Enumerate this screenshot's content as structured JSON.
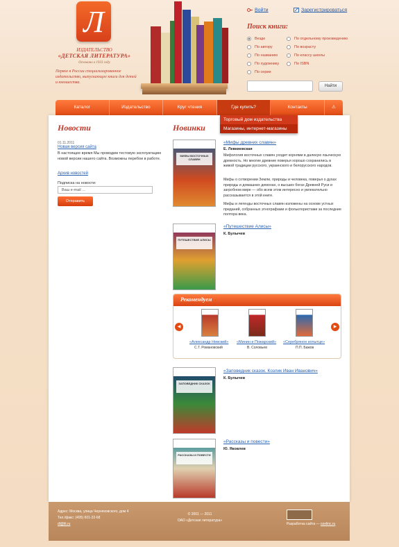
{
  "brand": {
    "logo_letter": "Л",
    "line1": "ИЗДАТЕЛЬСТВО",
    "line2": "«ДЕТСКАЯ ЛИТЕРАТУРА»",
    "founded": "Основано в 1933 году",
    "tagline": "Первое в России специализированное издательство, выпускающее книги для детей и юношества."
  },
  "auth": {
    "login": "Войти",
    "register": "Зарегистрироваться"
  },
  "search": {
    "title": "Поиск книги:",
    "options": [
      {
        "label": "Везде",
        "checked": true
      },
      {
        "label": "По отдельному произведению",
        "checked": false
      },
      {
        "label": "По автору",
        "checked": false
      },
      {
        "label": "По возрасту",
        "checked": false
      },
      {
        "label": "По названию",
        "checked": false
      },
      {
        "label": "По классу школы",
        "checked": false
      },
      {
        "label": "По художнику",
        "checked": false
      },
      {
        "label": "По ISBN",
        "checked": false
      },
      {
        "label": "По серии",
        "checked": false
      }
    ],
    "query": "",
    "button": "Найти"
  },
  "nav": {
    "items": [
      "Каталог",
      "Издательство",
      "Круг чтения",
      "Где купить?",
      "Контакты",
      "⚠"
    ],
    "active_index": 3,
    "dropdown": [
      "Торговый дом издательства",
      "Магазины, интернет-магазины"
    ]
  },
  "news": {
    "title": "Новости",
    "date": "01.11.2011",
    "headline": "Новая версия сайта",
    "text": "В настоящее время Мы проводим тестовую эксплуатацию новой версии нашего сайта. Возможны перебои в работе.",
    "archive": "Архив новостей",
    "subscribe_label": "Подписка на новости:",
    "email_placeholder": "Ваш e-mail ...",
    "send": "Отправить"
  },
  "new_books": {
    "title": "Новинки",
    "items": [
      {
        "title": "«Мифы древних славян»",
        "author": "Е. Левкиевская",
        "cover_title": "МИФЫ ВОСТОЧНЫХ СЛАВЯН",
        "paragraphs": [
          "Мифология восточных славян уходит корнями в далекую языческую древность. Но многие древние поверья хорошо сохранились в живой традиции русского, украинского и белорусского народов.",
          "Мифы о сотворении Земли, природы и человека, поверья о духах природы и домашних демонах, о высших богах Древней Руси и загробном мире — обо всем этом интересно и увлекательно рассказывается в этой книге.",
          "Мифы и легенды восточных славян изложены на основе устных преданий, собранных этнографами и фольклористами за последние полтора века."
        ]
      },
      {
        "title": "«Путешествие Алисы»",
        "author": "К. Булычев",
        "cover_title": "ПУТЕШЕСТВИЕ АЛИСЫ",
        "paragraphs": []
      },
      {
        "title": "«Заповедник сказок. Козлик Иван Иванович»",
        "author": "К. Булычев",
        "cover_title": "ЗАПОВЕДНИК СКАЗОК",
        "paragraphs": []
      },
      {
        "title": "«Рассказы и повести»",
        "author": "Ю. Яковлев",
        "cover_title": "РАССКАЗЫ И ПОВЕСТИ",
        "paragraphs": []
      }
    ]
  },
  "recommend": {
    "title": "Рекомендуем",
    "items": [
      {
        "title": "«Александр Невский»",
        "author": "С.Т. Романовский"
      },
      {
        "title": "«Минин и Пожарский»",
        "author": "В. Соловьев"
      },
      {
        "title": "«Серебряное копытце»",
        "author": "П.П. Бажов"
      }
    ]
  },
  "footer": {
    "address": "Адрес: Москва, улица Черняховского, дом 4",
    "phone": "Тел./факс: (495) 601-22-68",
    "email": "dl@lit.ru",
    "copyright1": "© 2001 — 2011",
    "copyright2": "ОАО «Детская литература»",
    "dev_label": "Разработка сайта —",
    "dev_link": "ozelinc.ru"
  },
  "colors": {
    "accent": "#e24b14",
    "title_red": "#c0392b",
    "link": "#2860b0",
    "footer": "#c0936a"
  }
}
